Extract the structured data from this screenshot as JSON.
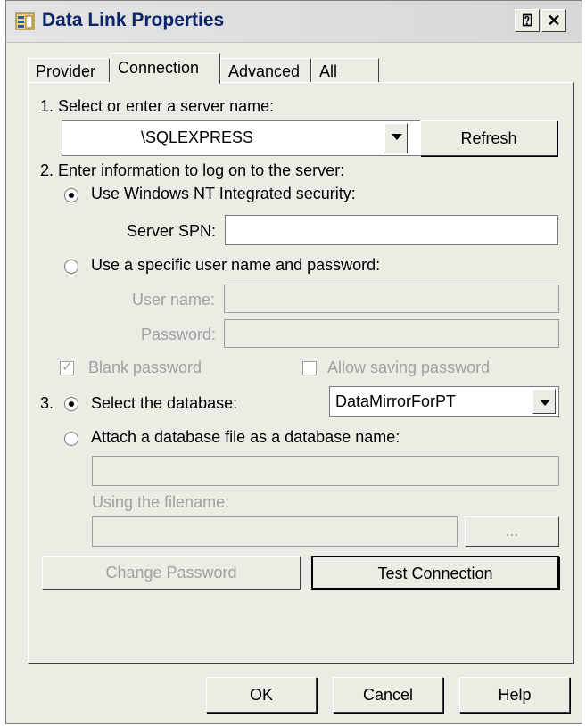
{
  "window": {
    "title": "Data Link Properties",
    "help_glyph": "⍰",
    "close_glyph": "✕"
  },
  "tabs": [
    {
      "label": "Provider"
    },
    {
      "label": "Connection",
      "active": true
    },
    {
      "label": "Advanced"
    },
    {
      "label": "All"
    }
  ],
  "step1": {
    "label": "1. Select or enter a server name:",
    "server_value": "\\SQLEXPRESS",
    "refresh": "Refresh"
  },
  "step2": {
    "label": "2. Enter information to log on to the server:",
    "option_nt": "Use Windows NT Integrated security:",
    "spn_label": "Server SPN:",
    "spn_value": "",
    "option_user": "Use a specific user name and password:",
    "username_label": "User name:",
    "password_label": "Password:",
    "blank_password": "Blank password",
    "allow_saving": "Allow saving password"
  },
  "step3": {
    "number": "3.",
    "option_select": "Select the database:",
    "database_value": "DataMirrorForPT",
    "option_attach": "Attach a database file as a database name:",
    "filename_label": "Using the filename:",
    "browse": "..."
  },
  "buttons": {
    "change_password": "Change Password",
    "test_connection": "Test Connection",
    "ok": "OK",
    "cancel": "Cancel",
    "help": "Help"
  }
}
